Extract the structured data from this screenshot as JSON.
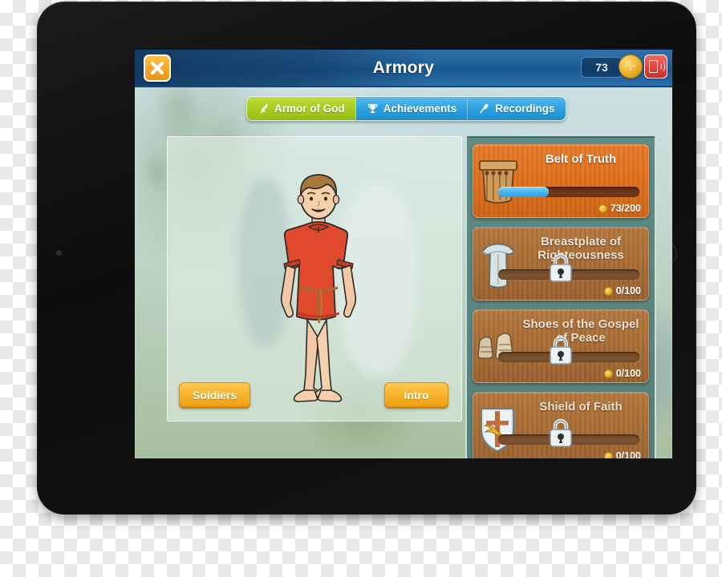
{
  "device": {
    "type": "tablet",
    "orientation": "landscape",
    "home_button": "home-button",
    "bezel_color": "#121212"
  },
  "header": {
    "title": "Armory",
    "close_icon": "close-x-icon",
    "coin_count": "73",
    "coin_icon": "dove-coin-icon",
    "audio_icon": "audio-speaker-icon",
    "bar_color": "#1f5c96",
    "close_button_color": "#f5a623",
    "audio_button_color": "#e0453c"
  },
  "tabs": [
    {
      "label": "Armor of God",
      "icon": "sword-icon",
      "active": true,
      "color": "#a7ce1f"
    },
    {
      "label": "Achievements",
      "icon": "trophy-icon",
      "active": false,
      "color": "#2e9fe0"
    },
    {
      "label": "Recordings",
      "icon": "microphone-icon",
      "active": false,
      "color": "#2e9fe0"
    }
  ],
  "character_panel": {
    "character_alt": "boy-in-red-tunic",
    "buttons": [
      {
        "label": "Soldiers",
        "name": "soldiers-button"
      },
      {
        "label": "Intro",
        "name": "intro-button"
      }
    ]
  },
  "armor_panel": {
    "background_color": "#557f7b",
    "items": [
      {
        "name": "Belt of Truth",
        "icon": "belt-icon",
        "locked": false,
        "progress_current": 73,
        "progress_max": 200,
        "progress_percent": 36,
        "cost_label": "73/200",
        "bar_color": "#44b2f0",
        "panel_color": "#df6f1c"
      },
      {
        "name": "Breastplate of Righteousness",
        "icon": "breastplate-icon",
        "locked": true,
        "progress_current": 0,
        "progress_max": 100,
        "progress_percent": 0,
        "cost_label": "0/100",
        "bar_color": "#44b2f0",
        "panel_color": "#a96d35"
      },
      {
        "name": "Shoes of the Gospel of Peace",
        "icon": "shoes-icon",
        "locked": true,
        "progress_current": 0,
        "progress_max": 100,
        "progress_percent": 0,
        "cost_label": "0/100",
        "bar_color": "#44b2f0",
        "panel_color": "#a96d35"
      },
      {
        "name": "Shield of Faith",
        "icon": "shield-icon",
        "locked": true,
        "progress_current": 0,
        "progress_max": 100,
        "progress_percent": 0,
        "cost_label": "0/100",
        "bar_color": "#44b2f0",
        "panel_color": "#a96d35"
      }
    ]
  }
}
